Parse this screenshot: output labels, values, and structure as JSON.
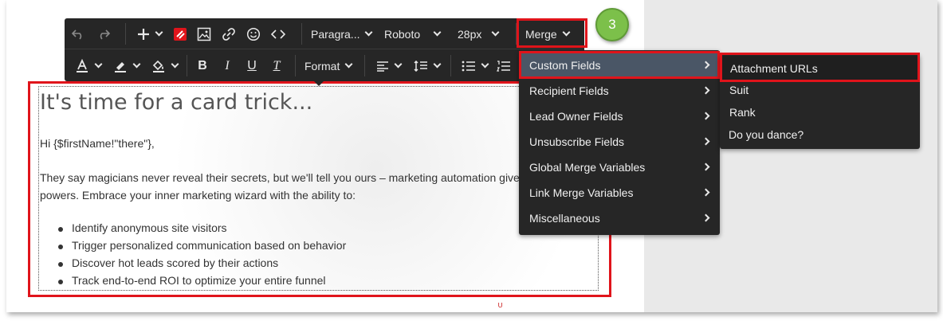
{
  "toolbar": {
    "row1": {
      "paragraph_label": "Paragra...",
      "font_label": "Roboto",
      "size_label": "28px",
      "merge_label": "Merge"
    },
    "row2": {
      "format_label": "Format"
    }
  },
  "step_badge": "3",
  "merge_menu": {
    "items": [
      {
        "label": "Custom Fields"
      },
      {
        "label": "Recipient Fields"
      },
      {
        "label": "Lead Owner Fields"
      },
      {
        "label": "Unsubscribe Fields"
      },
      {
        "label": "Global Merge Variables"
      },
      {
        "label": "Link Merge Variables"
      },
      {
        "label": "Miscellaneous"
      }
    ]
  },
  "custom_fields_menu": {
    "items": [
      {
        "label": "Attachment URLs"
      },
      {
        "label": "Suit"
      },
      {
        "label": "Rank"
      },
      {
        "label": "Do you dance?"
      }
    ]
  },
  "content": {
    "heading": "It's time for a card trick...",
    "greeting": "Hi {$firstName!\"there\"},",
    "body_line1": "They say magicians never reveal their secrets, but we'll tell you ours – marketing automation give",
    "body_line2": "powers. Embrace your inner marketing wizard with the ability to:",
    "bullets": [
      "Identify anonymous site visitors",
      "Trigger personalized communication based on behavior",
      "Discover hot leads scored by their actions",
      "Track end-to-end ROI to optimize your entire funnel"
    ]
  },
  "colors": {
    "toolbar_bg": "#262626",
    "highlight_red": "#e0141b",
    "badge_green": "#7cc04a",
    "menu_active": "#4a5666"
  }
}
